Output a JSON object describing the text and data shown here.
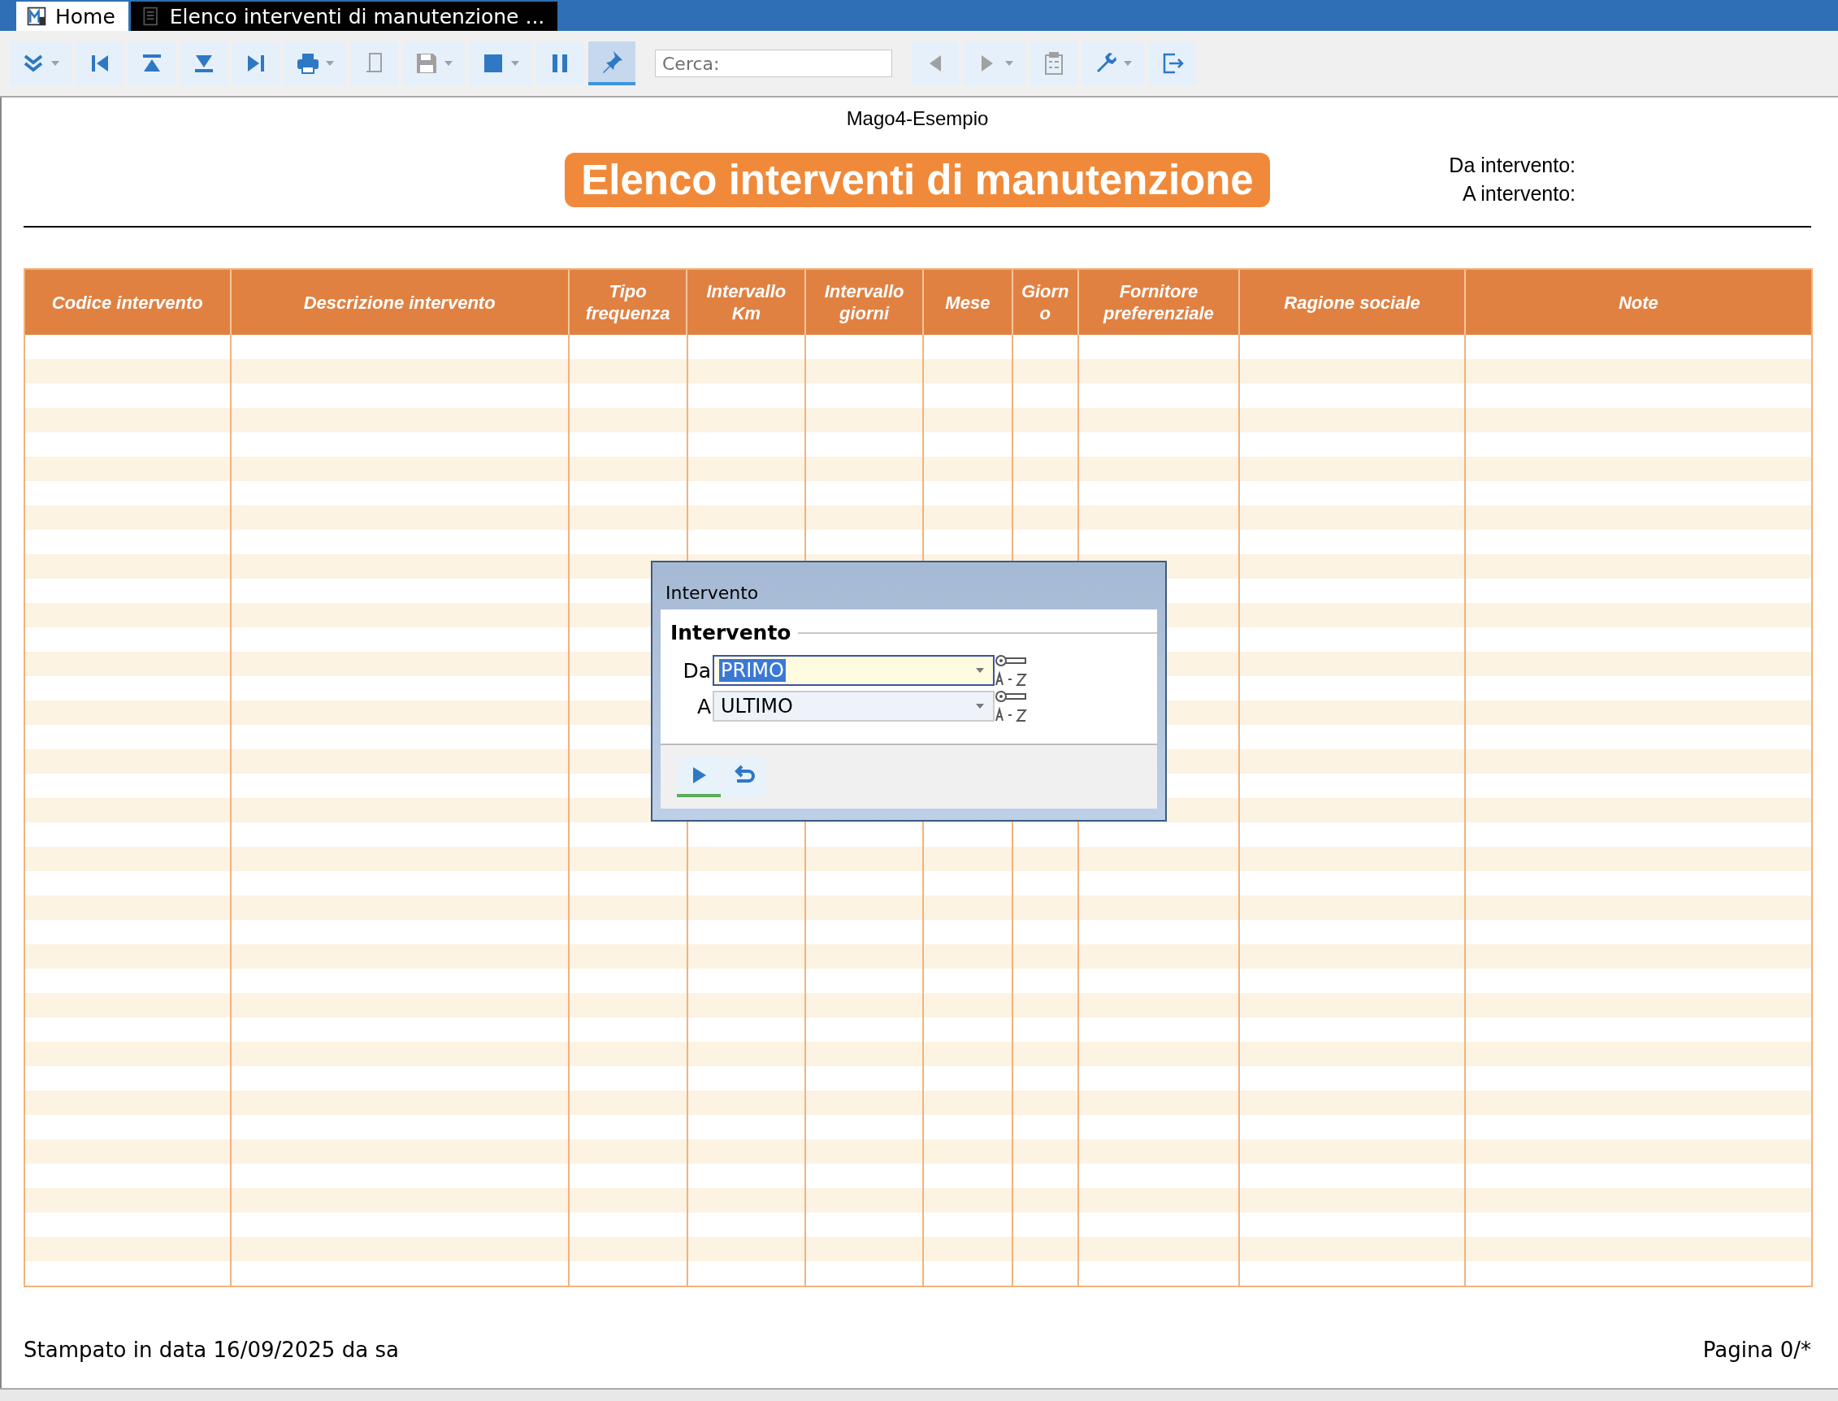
{
  "tabs": [
    {
      "label": "Home",
      "selected": false
    },
    {
      "label": "Elenco interventi di manutenzione ...",
      "selected": true
    }
  ],
  "toolbar": {
    "buttons": [
      {
        "dropdown": true,
        "disabled": false,
        "selected": false
      },
      {
        "dropdown": false,
        "disabled": false,
        "selected": false
      },
      {
        "dropdown": false,
        "disabled": false,
        "selected": false
      },
      {
        "dropdown": false,
        "disabled": false,
        "selected": false
      },
      {
        "dropdown": false,
        "disabled": false,
        "selected": false
      },
      {
        "dropdown": true,
        "disabled": false,
        "selected": false
      },
      {
        "dropdown": false,
        "disabled": true,
        "selected": false
      },
      {
        "dropdown": true,
        "disabled": true,
        "selected": false
      },
      {
        "dropdown": true,
        "disabled": false,
        "selected": false
      },
      {
        "dropdown": false,
        "disabled": false,
        "selected": false
      },
      {
        "dropdown": false,
        "disabled": false,
        "selected": true
      }
    ],
    "search": {
      "placeholder": "Cerca:"
    },
    "after_search": [
      {
        "dropdown": false,
        "disabled": true,
        "selected": false
      },
      {
        "dropdown": true,
        "disabled": true,
        "selected": false
      },
      {
        "dropdown": false,
        "disabled": true,
        "selected": false
      },
      {
        "dropdown": true,
        "disabled": false,
        "selected": false
      },
      {
        "dropdown": false,
        "disabled": false,
        "selected": false
      }
    ]
  },
  "report": {
    "company": "Mago4-Esempio",
    "title": "Elenco interventi di manutenzione",
    "filters": [
      "Da intervento:",
      "A intervento:"
    ],
    "table": {
      "columns": [
        "Codice intervento",
        "Descrizione intervento",
        "Tipo frequenza",
        "Intervallo Km",
        "Intervallo giorni",
        "Mese",
        "Giorno",
        "Fornitore preferenziale",
        "Ragione sociale",
        "Note"
      ]
    },
    "footer_left": "Stampato in data 16/09/2025 da sa",
    "footer_right": "Pagina 0/*"
  },
  "dialog": {
    "title": "Intervento",
    "group": "Intervento",
    "fields": [
      {
        "label": "Da",
        "value": "PRIMO",
        "focused": true
      },
      {
        "label": "A",
        "value": "ULTIMO",
        "focused": false
      }
    ],
    "buttons": [
      {
        "selected": true
      },
      {
        "selected": false
      }
    ]
  }
}
